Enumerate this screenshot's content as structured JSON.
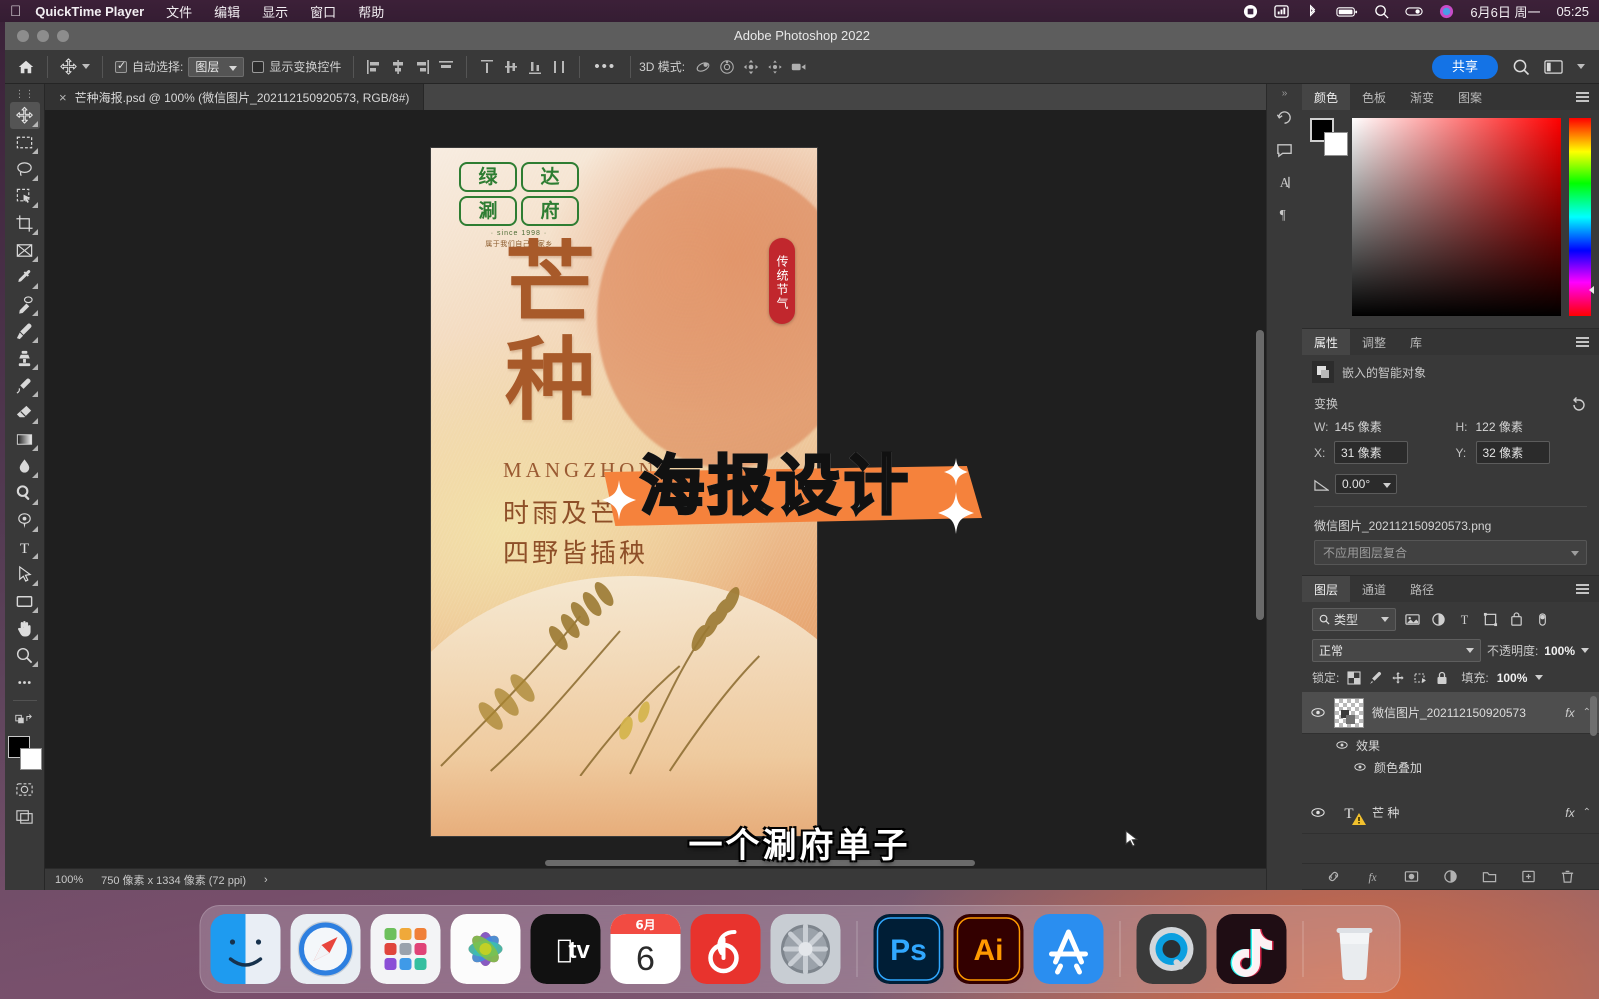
{
  "menubar": {
    "apple": "apple-logo",
    "app": "QuickTime Player",
    "items": [
      "文件",
      "编辑",
      "显示",
      "窗口",
      "帮助"
    ],
    "date": "6月6日 周一",
    "time": "05:25"
  },
  "window": {
    "title": "Adobe Photoshop 2022"
  },
  "options_bar": {
    "home": "home-icon",
    "tool": "move-tool",
    "auto_select_label": "自动选择:",
    "auto_select_value": "图层",
    "show_transform_label": "显示变换控件",
    "more": "•••",
    "mode_3d_label": "3D 模式:",
    "share_label": "共享",
    "search": "search-icon",
    "workspace": "workspace-icon"
  },
  "document_tab": {
    "close": "×",
    "title": "芒种海报.psd @ 100% (微信图片_202112150920573, RGB/8#)"
  },
  "toolbar": {
    "tools": [
      {
        "name": "move-tool",
        "active": true
      },
      {
        "name": "rectangular-marquee-tool",
        "active": false
      },
      {
        "name": "lasso-tool",
        "active": false
      },
      {
        "name": "object-selection-tool",
        "active": false
      },
      {
        "name": "crop-tool",
        "active": false
      },
      {
        "name": "frame-tool",
        "active": false
      },
      {
        "name": "eyedropper-tool",
        "active": false
      },
      {
        "name": "spot-healing-brush-tool",
        "active": false
      },
      {
        "name": "brush-tool",
        "active": false
      },
      {
        "name": "clone-stamp-tool",
        "active": false
      },
      {
        "name": "history-brush-tool",
        "active": false
      },
      {
        "name": "eraser-tool",
        "active": false
      },
      {
        "name": "gradient-tool",
        "active": false
      },
      {
        "name": "blur-tool",
        "active": false
      },
      {
        "name": "dodge-tool",
        "active": false
      },
      {
        "name": "pen-tool",
        "active": false
      },
      {
        "name": "type-tool",
        "active": false
      },
      {
        "name": "path-selection-tool",
        "active": false
      },
      {
        "name": "rectangle-tool",
        "active": false
      },
      {
        "name": "hand-tool",
        "active": false
      },
      {
        "name": "zoom-tool",
        "active": false
      },
      {
        "name": "edit-toolbar-button",
        "active": false
      }
    ],
    "foreground_color": "#000000",
    "background_color": "#ffffff"
  },
  "poster": {
    "logo_cells": [
      "绿",
      "达",
      "涮",
      "府"
    ],
    "logo_since": "· since 1998 ·",
    "logo_slogan": "属于我们自己的家乡",
    "badge": "传统节气",
    "title": "芒种",
    "pinyin": "MANGZHONG",
    "couplet_line1": "时雨及芒种",
    "couplet_line2": "四野皆插秧"
  },
  "status_bar": {
    "zoom": "100%",
    "dimensions": "750 像素 x 1334 像素 (72 ppi)",
    "arrow": "›"
  },
  "right_strip": {
    "icons": [
      "history-icon",
      "comment-icon",
      "character-icon",
      "paragraph-icon"
    ],
    "collapse": "»"
  },
  "color_panel": {
    "tabs": [
      "颜色",
      "色板",
      "渐变",
      "图案"
    ],
    "active_tab": "颜色",
    "menu": "panel-menu-icon",
    "foreground": "#000000",
    "background": "#ffffff"
  },
  "properties_panel": {
    "tabs": [
      "属性",
      "调整",
      "库"
    ],
    "active_tab": "属性",
    "object_type": "嵌入的智能对象",
    "section_transform": "变换",
    "reset": "reset-icon",
    "w_label": "W:",
    "w_value": "145 像素",
    "h_label": "H:",
    "h_value": "122 像素",
    "x_label": "X:",
    "x_value": "31 像素",
    "y_label": "Y:",
    "y_value": "32 像素",
    "angle_value": "0.00°",
    "filename": "微信图片_202112150920573.png",
    "layer_comp": "不应用图层复合"
  },
  "layers_panel": {
    "tabs": [
      "图层",
      "通道",
      "路径"
    ],
    "active_tab": "图层",
    "filter_label": "类型",
    "filter_icons": [
      "pixel-filter-icon",
      "adjustment-filter-icon",
      "type-filter-icon",
      "shape-filter-icon",
      "smart-object-filter-icon"
    ],
    "filter_toggle": "filter-toggle-icon",
    "blend_mode": "正常",
    "opacity_label": "不透明度:",
    "opacity_value": "100%",
    "lock_label": "锁定:",
    "fill_label": "填充:",
    "fill_value": "100%",
    "layers": [
      {
        "name": "微信图片_202112150920573",
        "selected": true,
        "fx": "fx",
        "effects_label": "效果",
        "effects": [
          "颜色叠加"
        ]
      },
      {
        "name": "芒 种",
        "selected": false,
        "fx": "fx",
        "type": "text",
        "warning": true
      }
    ],
    "footer_icons": [
      "link-layers-icon",
      "add-style-icon",
      "add-mask-icon",
      "new-fill-adjustment-icon",
      "new-group-icon",
      "new-layer-icon",
      "delete-layer-icon"
    ]
  },
  "video_overlay": {
    "title": "海报设计",
    "banner_color": "#f5823c",
    "caption": "一个涮府单子"
  },
  "dock": {
    "items": [
      {
        "name": "finder",
        "label": "Finder"
      },
      {
        "name": "safari",
        "label": "Safari"
      },
      {
        "name": "launchpad",
        "label": "Launchpad"
      },
      {
        "name": "photos",
        "label": "照片"
      },
      {
        "name": "apple-tv",
        "label": "Apple TV"
      },
      {
        "name": "calendar",
        "label": "日历",
        "month": "6月",
        "day": "6"
      },
      {
        "name": "netease-music",
        "label": "网易云音乐"
      },
      {
        "name": "system-preferences",
        "label": "系统偏好设置"
      },
      {
        "name": "photoshop",
        "label": "Ps"
      },
      {
        "name": "illustrator",
        "label": "Ai"
      },
      {
        "name": "app-store",
        "label": "App Store"
      },
      {
        "name": "quicktime-player",
        "label": "QuickTime Player"
      },
      {
        "name": "tiktok",
        "label": "抖音"
      },
      {
        "name": "trash",
        "label": "废纸篓"
      }
    ]
  }
}
